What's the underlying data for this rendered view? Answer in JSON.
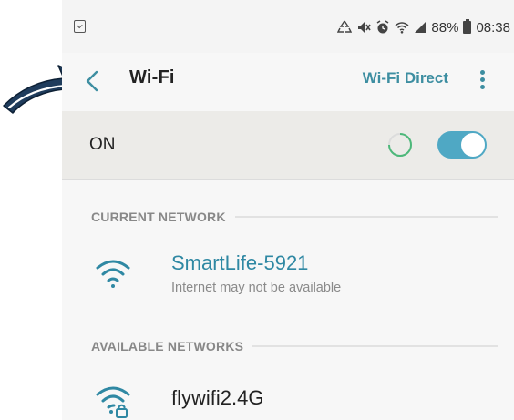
{
  "status_bar": {
    "battery": "88%",
    "time": "08:38",
    "icons": [
      "screenshot-icon",
      "recycle-icon",
      "mute-icon",
      "alarm-icon",
      "wifi-icon",
      "signal-icon",
      "battery-icon"
    ]
  },
  "header": {
    "title": "Wi-Fi",
    "wifi_direct": "Wi-Fi Direct",
    "back_icon": "chevron-left-icon",
    "more_icon": "more-vert-icon"
  },
  "toggle_row": {
    "label": "ON",
    "state": true
  },
  "current_section": {
    "title": "CURRENT NETWORK",
    "network": {
      "name": "SmartLife-5921",
      "status": "Internet may not be available",
      "icon": "wifi-icon"
    }
  },
  "available_section": {
    "title": "AVAILABLE NETWORKS",
    "networks": [
      {
        "name": "flywifi2.4G",
        "icon": "wifi-lock-icon"
      }
    ]
  },
  "colors": {
    "accent": "#3d8ea1",
    "toggle": "#4fa8c4",
    "current_network": "#2f88a3",
    "annotation_arrow": "#1f3c5c"
  }
}
